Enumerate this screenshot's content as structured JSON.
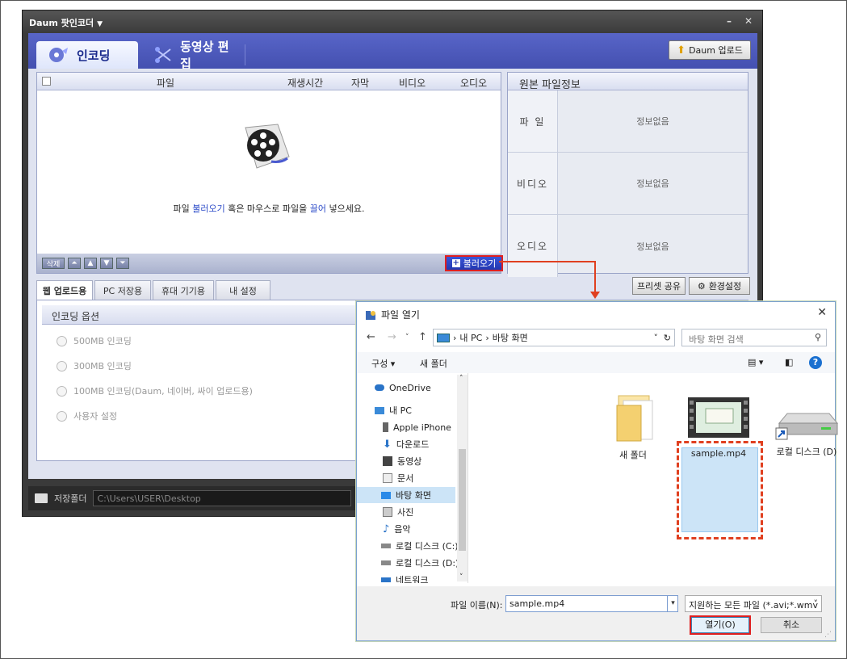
{
  "app": {
    "title": "Daum 팟인코더",
    "tabs": [
      {
        "label": "인코딩"
      },
      {
        "label": "동영상 편집"
      }
    ],
    "upload_label": "Daum 업로드",
    "file_list": {
      "columns": [
        "파일",
        "재생시간",
        "자막",
        "비디오",
        "오디오"
      ],
      "empty_prefix": "파일 ",
      "empty_link1": "불러오기",
      "empty_middle": " 혹은 마우스로 파일을 ",
      "empty_link2": "끌어",
      "empty_suffix": " 넣으세요.",
      "delete_label": "삭제",
      "load_label": "불러오기"
    },
    "source_info": {
      "title": "원본 파일정보",
      "rows": [
        {
          "label": "파 일",
          "value": "정보없음"
        },
        {
          "label": "비디오",
          "value": "정보없음"
        },
        {
          "label": "오디오",
          "value": "정보없음"
        }
      ]
    },
    "subtabs": [
      "웹 업로드용",
      "PC 저장용",
      "휴대 기기용",
      "내 설정"
    ],
    "preset_share_label": "프리셋 공유",
    "settings_label": "환경설정",
    "options": {
      "title": "인코딩 옵션",
      "items": [
        "500MB 인코딩",
        "300MB 인코딩",
        "100MB 인코딩(Daum, 네이버, 싸이 업로드용)",
        "사용자 설정"
      ]
    },
    "save_folder": {
      "label": "저장폴더",
      "path": "C:\\Users\\USER\\Desktop"
    }
  },
  "dialog": {
    "title": "파일 열기",
    "breadcrumb": [
      "내 PC",
      "바탕 화면"
    ],
    "search_placeholder": "바탕 화면 검색",
    "toolbar": {
      "organize": "구성 ▾",
      "new_folder": "새 폴더"
    },
    "nav_items": [
      {
        "label": "OneDrive"
      },
      {
        "label": "내 PC"
      },
      {
        "label": "Apple iPhone"
      },
      {
        "label": "다운로드"
      },
      {
        "label": "동영상"
      },
      {
        "label": "문서"
      },
      {
        "label": "바탕 화면"
      },
      {
        "label": "사진"
      },
      {
        "label": "음악"
      },
      {
        "label": "로컬 디스크 (C:)"
      },
      {
        "label": "로컬 디스크 (D:)"
      },
      {
        "label": "네트워크"
      }
    ],
    "files": [
      {
        "label": "새 폴더"
      },
      {
        "label": "sample.mp4"
      },
      {
        "label": "로컬 디스크 (D)"
      }
    ],
    "filename_label": "파일 이름(N):",
    "filename_value": "sample.mp4",
    "filetype_value": "지원하는 모든 파일 (*.avi;*.wmv",
    "open_label": "열기(O)",
    "cancel_label": "취소"
  }
}
